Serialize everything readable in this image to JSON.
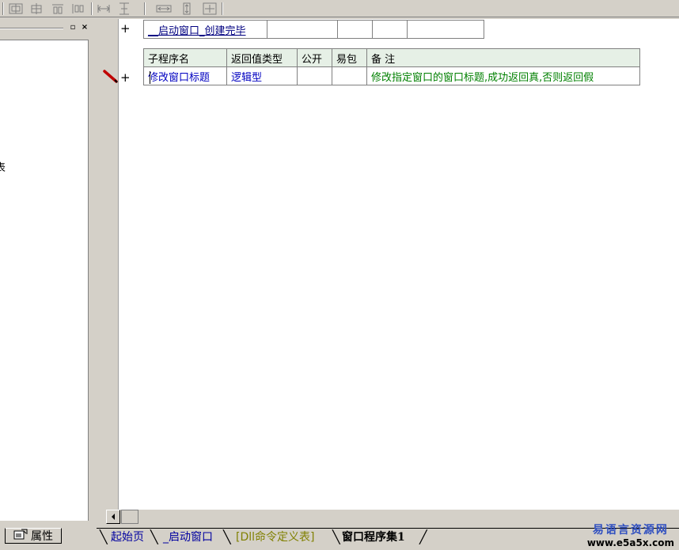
{
  "toolbar": {
    "icons": [
      "align-left-icon",
      "align-center-icon",
      "align-right-icon",
      "distribute-icon",
      "equal-width-icon",
      "equal-height-icon",
      "same-width-icon",
      "same-height-icon",
      "same-size-icon"
    ]
  },
  "left_panel": {
    "pin_label": "▫",
    "close_label": "×",
    "cut_text": "表",
    "properties_tab": "属性"
  },
  "editor": {
    "event_row": {
      "plus": "+",
      "name": "__启动窗口_创建完毕"
    },
    "sub_table": {
      "headers": [
        "子程序名",
        "返回值类型",
        "公开",
        "易包",
        "备 注"
      ],
      "row": {
        "plus": "+",
        "name": "修改窗口标题",
        "return_type": "逻辑型",
        "public": "",
        "easy_pack": "",
        "note": "修改指定窗口的窗口标题,成功返回真,否则返回假"
      }
    },
    "colors": {
      "keyword": "#0000c0",
      "comment": "#008000",
      "header_bg": "#e6f0e6"
    }
  },
  "tabs": [
    {
      "label": "起始页"
    },
    {
      "label": "_启动窗口"
    },
    {
      "label": "[Dll命令定义表]"
    },
    {
      "label": "窗口程序集1",
      "active": true
    }
  ],
  "watermark": {
    "cn": "易语言资源网",
    "url": "www.e5a5x.com"
  }
}
